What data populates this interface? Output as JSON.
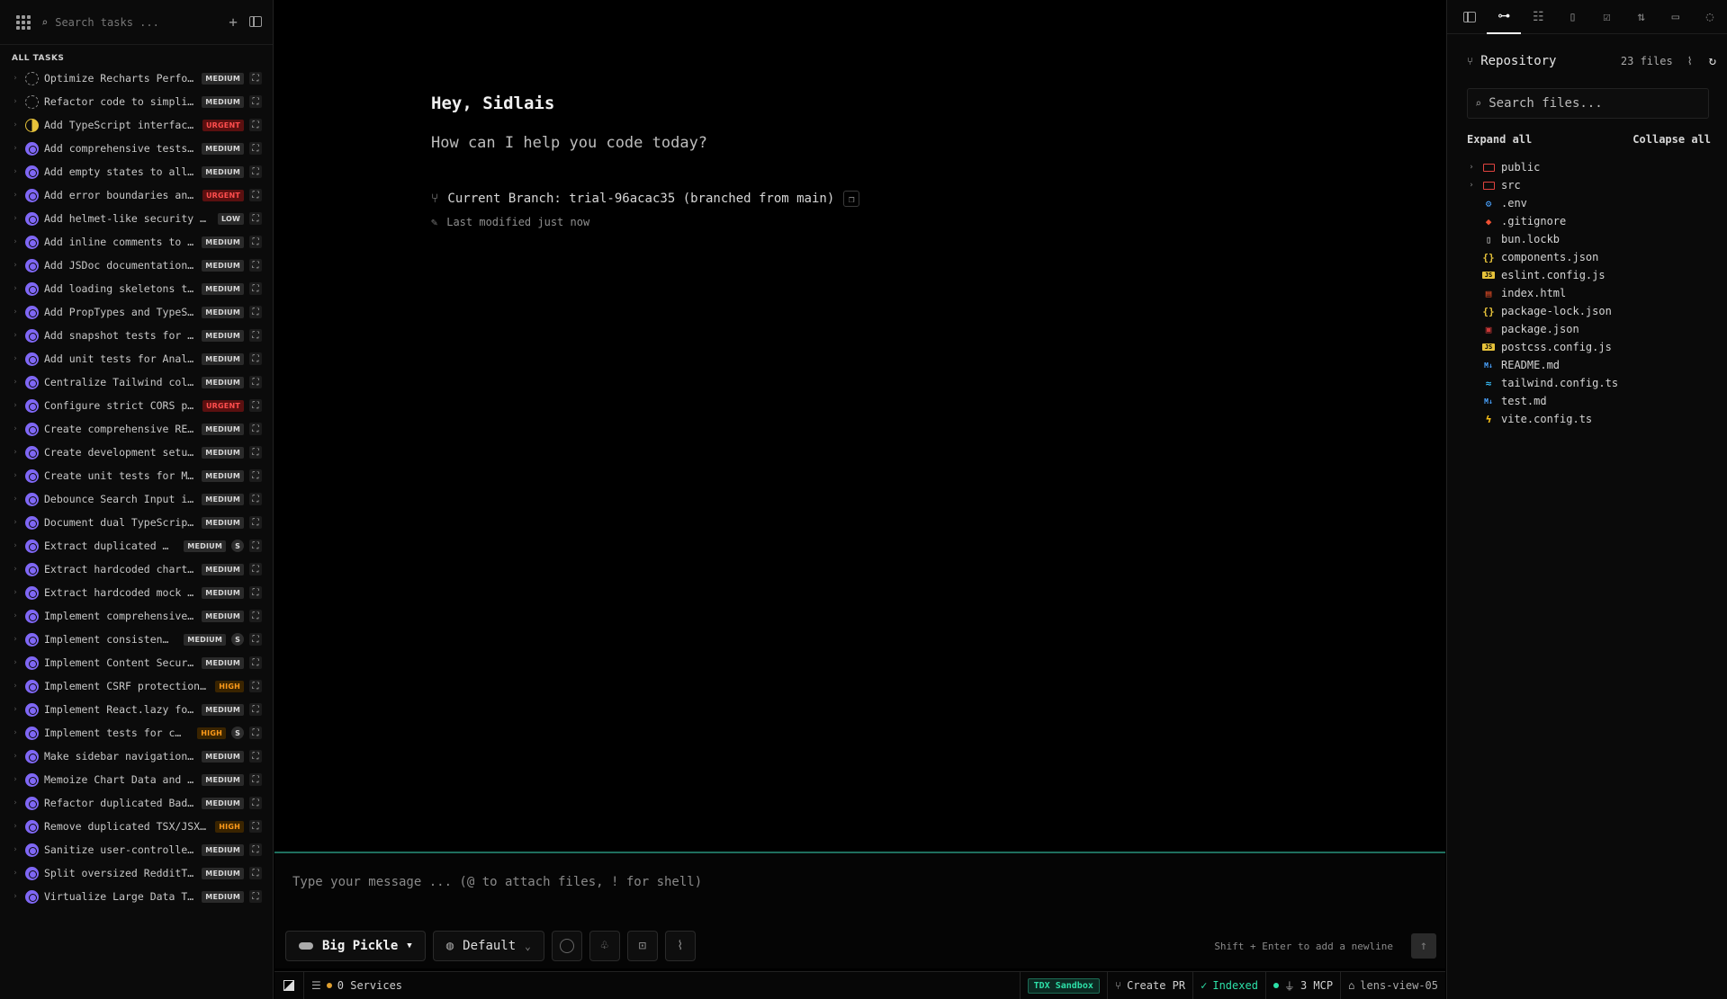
{
  "sidebar": {
    "search_placeholder": "Search tasks ...",
    "section_label": "ALL TASKS",
    "tasks": [
      {
        "title": "Optimize Recharts Perfo…",
        "priority": "MEDIUM",
        "status": "todo"
      },
      {
        "title": "Refactor code to simpli…",
        "priority": "MEDIUM",
        "status": "todo"
      },
      {
        "title": "Add TypeScript interfac…",
        "priority": "URGENT",
        "status": "progress"
      },
      {
        "title": "Add comprehensive tests…",
        "priority": "MEDIUM",
        "status": "done"
      },
      {
        "title": "Add empty states to all…",
        "priority": "MEDIUM",
        "status": "done"
      },
      {
        "title": "Add error boundaries an…",
        "priority": "URGENT",
        "status": "done"
      },
      {
        "title": "Add helmet-like security …",
        "priority": "LOW",
        "status": "done"
      },
      {
        "title": "Add inline comments to …",
        "priority": "MEDIUM",
        "status": "done"
      },
      {
        "title": "Add JSDoc documentation…",
        "priority": "MEDIUM",
        "status": "done"
      },
      {
        "title": "Add loading skeletons t…",
        "priority": "MEDIUM",
        "status": "done"
      },
      {
        "title": "Add PropTypes and TypeS…",
        "priority": "MEDIUM",
        "status": "done"
      },
      {
        "title": "Add snapshot tests for …",
        "priority": "MEDIUM",
        "status": "done"
      },
      {
        "title": "Add unit tests for Anal…",
        "priority": "MEDIUM",
        "status": "done"
      },
      {
        "title": "Centralize Tailwind col…",
        "priority": "MEDIUM",
        "status": "done"
      },
      {
        "title": "Configure strict CORS p…",
        "priority": "URGENT",
        "status": "done"
      },
      {
        "title": "Create comprehensive RE…",
        "priority": "MEDIUM",
        "status": "done"
      },
      {
        "title": "Create development setu…",
        "priority": "MEDIUM",
        "status": "done"
      },
      {
        "title": "Create unit tests for M…",
        "priority": "MEDIUM",
        "status": "done"
      },
      {
        "title": "Debounce Search Input i…",
        "priority": "MEDIUM",
        "status": "done"
      },
      {
        "title": "Document dual TypeScrip…",
        "priority": "MEDIUM",
        "status": "done"
      },
      {
        "title": "Extract duplicated …",
        "priority": "MEDIUM",
        "status": "done",
        "s": "S"
      },
      {
        "title": "Extract hardcoded chart…",
        "priority": "MEDIUM",
        "status": "done"
      },
      {
        "title": "Extract hardcoded mock …",
        "priority": "MEDIUM",
        "status": "done"
      },
      {
        "title": "Implement comprehensive…",
        "priority": "MEDIUM",
        "status": "done"
      },
      {
        "title": "Implement consisten…",
        "priority": "MEDIUM",
        "status": "done",
        "s": "S"
      },
      {
        "title": "Implement Content Secur…",
        "priority": "MEDIUM",
        "status": "done"
      },
      {
        "title": "Implement CSRF protection…",
        "priority": "HIGH",
        "status": "done"
      },
      {
        "title": "Implement React.lazy fo…",
        "priority": "MEDIUM",
        "status": "done"
      },
      {
        "title": "Implement tests for c…",
        "priority": "HIGH",
        "status": "done",
        "s": "S"
      },
      {
        "title": "Make sidebar navigation…",
        "priority": "MEDIUM",
        "status": "done"
      },
      {
        "title": "Memoize Chart Data and …",
        "priority": "MEDIUM",
        "status": "done"
      },
      {
        "title": "Refactor duplicated Bad…",
        "priority": "MEDIUM",
        "status": "done"
      },
      {
        "title": "Remove duplicated TSX/JSX…",
        "priority": "HIGH",
        "status": "done"
      },
      {
        "title": "Sanitize user-controlle…",
        "priority": "MEDIUM",
        "status": "done"
      },
      {
        "title": "Split oversized RedditT…",
        "priority": "MEDIUM",
        "status": "done"
      },
      {
        "title": "Virtualize Large Data T…",
        "priority": "MEDIUM",
        "status": "done"
      }
    ]
  },
  "main": {
    "greeting": "Hey, Sidlais",
    "subtitle": "How can I help you code today?",
    "branch": "Current Branch: trial-96acac35 (branched from main)",
    "modified": "Last modified just now",
    "composer": {
      "placeholder": "Type your message ... (@ to attach files, ! for shell)",
      "model": "Big Pickle",
      "mode": "Default",
      "hint": "Shift + Enter to add a newline"
    }
  },
  "statusbar": {
    "services": "0 Services",
    "sandbox": "TDX Sandbox",
    "create_pr": "Create PR",
    "indexed": "Indexed",
    "mcp": "3 MCP",
    "view": "lens-view-05"
  },
  "repository": {
    "title": "Repository",
    "count": "23 files",
    "search_placeholder": "Search files...",
    "expand_all": "Expand all",
    "collapse_all": "Collapse all",
    "tree": [
      {
        "name": "public",
        "type": "folder"
      },
      {
        "name": "src",
        "type": "folder"
      },
      {
        "name": ".env",
        "type": "env"
      },
      {
        "name": ".gitignore",
        "type": "git"
      },
      {
        "name": "bun.lockb",
        "type": "file"
      },
      {
        "name": "components.json",
        "type": "json"
      },
      {
        "name": "eslint.config.js",
        "type": "js"
      },
      {
        "name": "index.html",
        "type": "html"
      },
      {
        "name": "package-lock.json",
        "type": "json"
      },
      {
        "name": "package.json",
        "type": "npm"
      },
      {
        "name": "postcss.config.js",
        "type": "js"
      },
      {
        "name": "README.md",
        "type": "md"
      },
      {
        "name": "tailwind.config.ts",
        "type": "tailwind"
      },
      {
        "name": "test.md",
        "type": "md"
      },
      {
        "name": "vite.config.ts",
        "type": "vite"
      }
    ]
  },
  "colors": {
    "accent_purple": "#7f67f5",
    "urgent": "#ff4d4d",
    "high": "#ff9b1a",
    "indexed_green": "#2de0a8",
    "composer_border": "#1f6f5e"
  }
}
